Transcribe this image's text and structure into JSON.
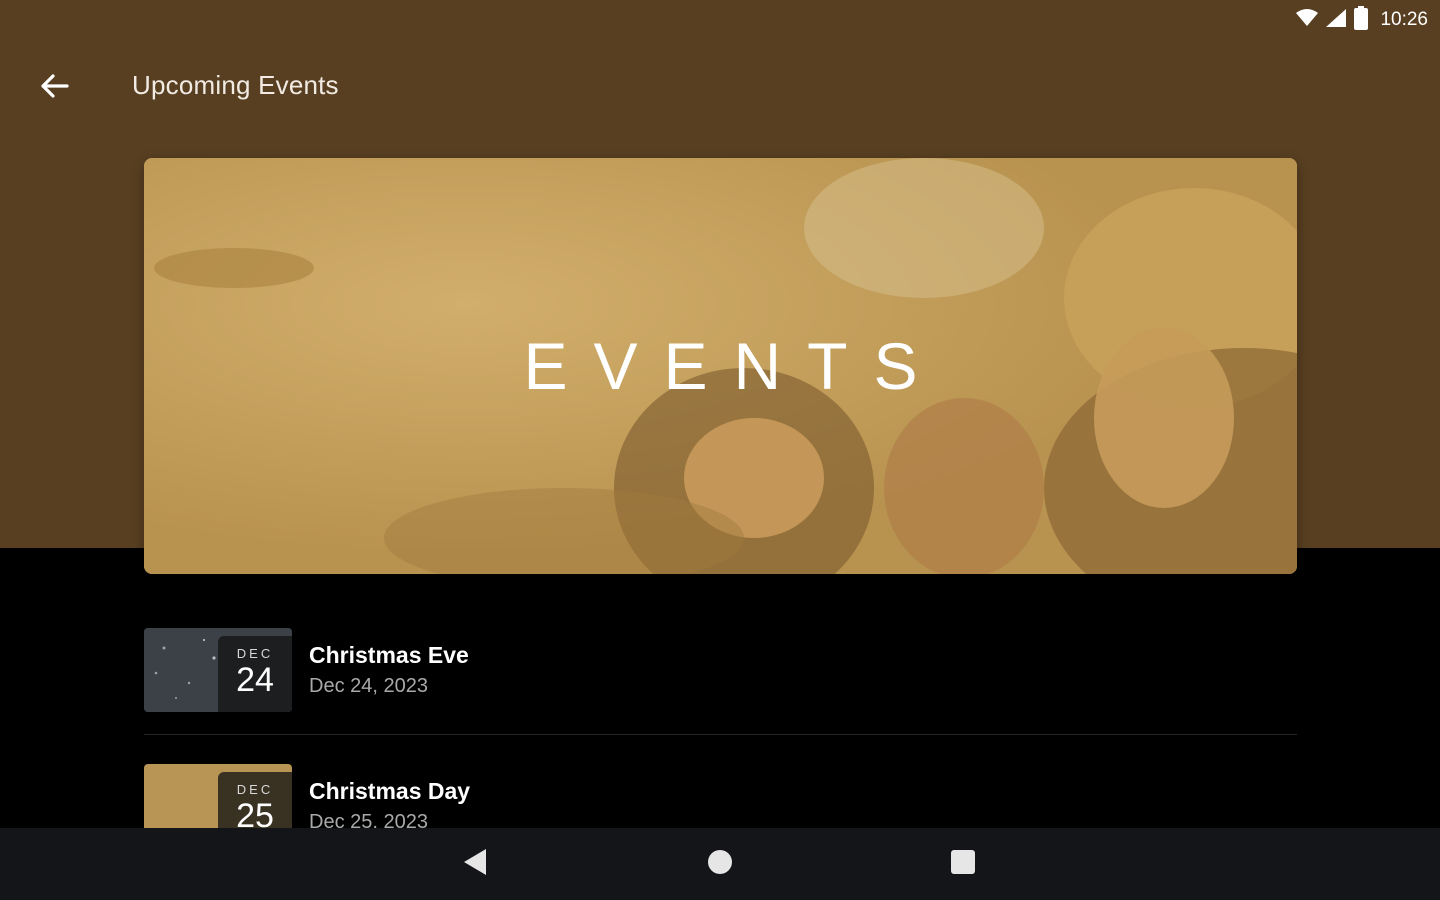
{
  "status_bar": {
    "time": "10:26",
    "icons": [
      "wifi-icon",
      "cellular-signal-icon",
      "battery-icon"
    ]
  },
  "app_bar": {
    "back_icon": "arrow-left-icon",
    "title": "Upcoming Events"
  },
  "hero": {
    "title": "EVENTS",
    "overlay_color": "#c9a04e"
  },
  "events": [
    {
      "name": "Christmas Eve",
      "date": "Dec 24, 2023",
      "badge_month": "DEC",
      "badge_day": "24"
    },
    {
      "name": "Christmas Day",
      "date": "Dec 25, 2023",
      "badge_month": "DEC",
      "badge_day": "25"
    }
  ],
  "nav_bar": {
    "icons": [
      "nav-back-icon",
      "nav-home-icon",
      "nav-recents-icon"
    ]
  },
  "colors": {
    "header_bg": "#583f21",
    "body_bg": "#000000",
    "nav_bg": "#141518"
  }
}
